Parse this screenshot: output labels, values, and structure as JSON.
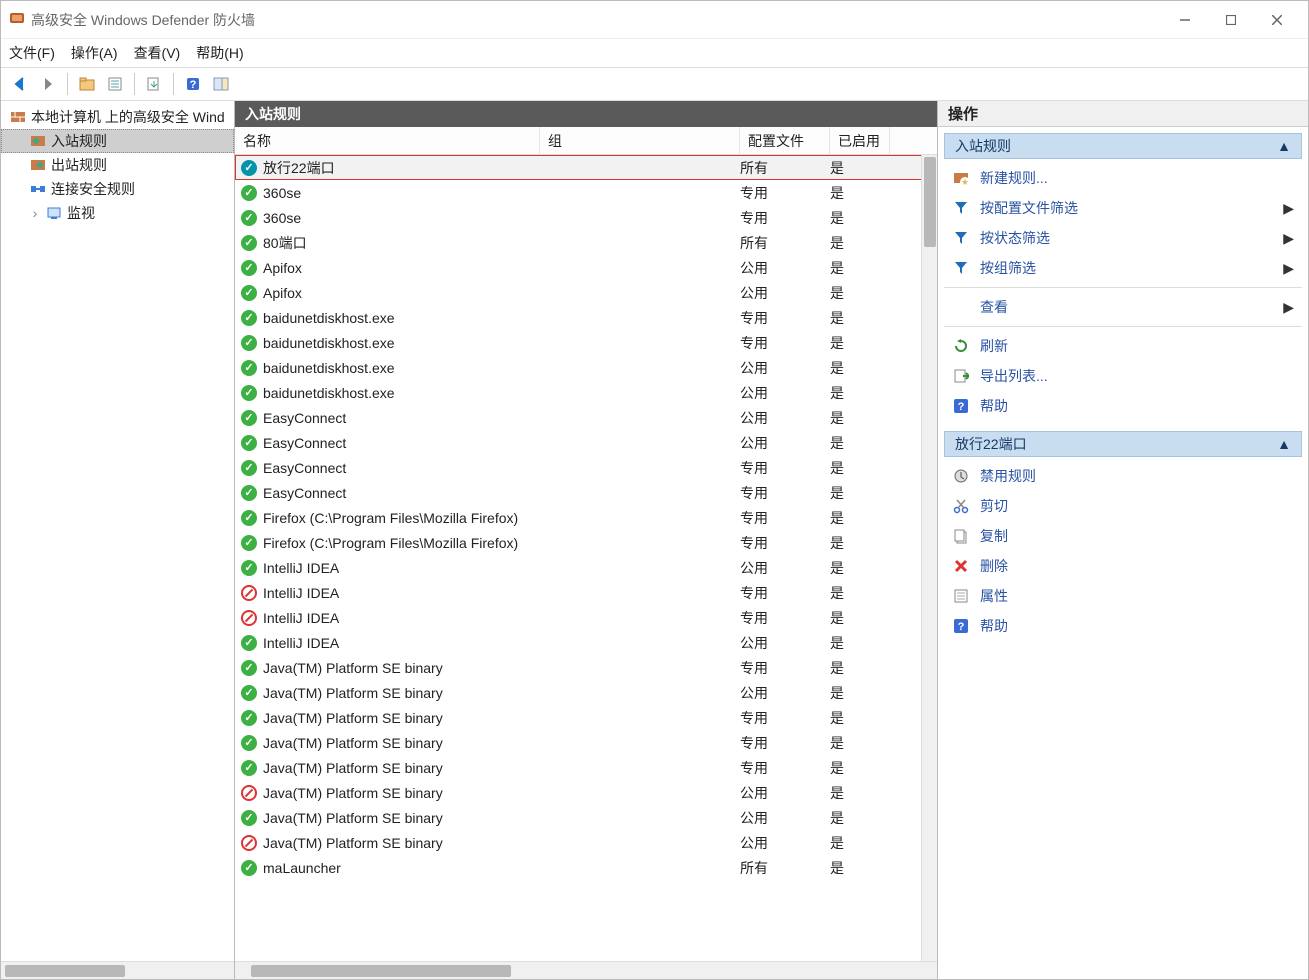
{
  "window": {
    "title": "高级安全 Windows Defender 防火墙"
  },
  "menu": {
    "file": "文件(F)",
    "action": "操作(A)",
    "view": "查看(V)",
    "help": "帮助(H)"
  },
  "tree": {
    "root": "本地计算机 上的高级安全 Wind",
    "inbound": "入站规则",
    "outbound": "出站规则",
    "connsec": "连接安全规则",
    "monitor": "监视"
  },
  "center": {
    "title": "入站规则",
    "columns": {
      "name": "名称",
      "group": "组",
      "profile": "配置文件",
      "enabled": "已启用"
    },
    "rules": [
      {
        "name": "放行22端口",
        "group": "",
        "profile": "所有",
        "enabled": "是",
        "icon": "custom",
        "selected": true,
        "highlighted": true
      },
      {
        "name": "360se",
        "group": "",
        "profile": "专用",
        "enabled": "是",
        "icon": "allow"
      },
      {
        "name": "360se",
        "group": "",
        "profile": "专用",
        "enabled": "是",
        "icon": "allow"
      },
      {
        "name": "80端口",
        "group": "",
        "profile": "所有",
        "enabled": "是",
        "icon": "allow"
      },
      {
        "name": "Apifox",
        "group": "",
        "profile": "公用",
        "enabled": "是",
        "icon": "allow"
      },
      {
        "name": "Apifox",
        "group": "",
        "profile": "公用",
        "enabled": "是",
        "icon": "allow"
      },
      {
        "name": "baidunetdiskhost.exe",
        "group": "",
        "profile": "专用",
        "enabled": "是",
        "icon": "allow"
      },
      {
        "name": "baidunetdiskhost.exe",
        "group": "",
        "profile": "专用",
        "enabled": "是",
        "icon": "allow"
      },
      {
        "name": "baidunetdiskhost.exe",
        "group": "",
        "profile": "公用",
        "enabled": "是",
        "icon": "allow"
      },
      {
        "name": "baidunetdiskhost.exe",
        "group": "",
        "profile": "公用",
        "enabled": "是",
        "icon": "allow"
      },
      {
        "name": "EasyConnect",
        "group": "",
        "profile": "公用",
        "enabled": "是",
        "icon": "allow"
      },
      {
        "name": "EasyConnect",
        "group": "",
        "profile": "公用",
        "enabled": "是",
        "icon": "allow"
      },
      {
        "name": "EasyConnect",
        "group": "",
        "profile": "专用",
        "enabled": "是",
        "icon": "allow"
      },
      {
        "name": "EasyConnect",
        "group": "",
        "profile": "专用",
        "enabled": "是",
        "icon": "allow"
      },
      {
        "name": "Firefox (C:\\Program Files\\Mozilla Firefox)",
        "group": "",
        "profile": "专用",
        "enabled": "是",
        "icon": "allow"
      },
      {
        "name": "Firefox (C:\\Program Files\\Mozilla Firefox)",
        "group": "",
        "profile": "专用",
        "enabled": "是",
        "icon": "allow"
      },
      {
        "name": "IntelliJ IDEA",
        "group": "",
        "profile": "公用",
        "enabled": "是",
        "icon": "allow"
      },
      {
        "name": "IntelliJ IDEA",
        "group": "",
        "profile": "专用",
        "enabled": "是",
        "icon": "block"
      },
      {
        "name": "IntelliJ IDEA",
        "group": "",
        "profile": "专用",
        "enabled": "是",
        "icon": "block"
      },
      {
        "name": "IntelliJ IDEA",
        "group": "",
        "profile": "公用",
        "enabled": "是",
        "icon": "allow"
      },
      {
        "name": "Java(TM) Platform SE binary",
        "group": "",
        "profile": "专用",
        "enabled": "是",
        "icon": "allow"
      },
      {
        "name": "Java(TM) Platform SE binary",
        "group": "",
        "profile": "公用",
        "enabled": "是",
        "icon": "allow"
      },
      {
        "name": "Java(TM) Platform SE binary",
        "group": "",
        "profile": "专用",
        "enabled": "是",
        "icon": "allow"
      },
      {
        "name": "Java(TM) Platform SE binary",
        "group": "",
        "profile": "专用",
        "enabled": "是",
        "icon": "allow"
      },
      {
        "name": "Java(TM) Platform SE binary",
        "group": "",
        "profile": "专用",
        "enabled": "是",
        "icon": "allow"
      },
      {
        "name": "Java(TM) Platform SE binary",
        "group": "",
        "profile": "公用",
        "enabled": "是",
        "icon": "block"
      },
      {
        "name": "Java(TM) Platform SE binary",
        "group": "",
        "profile": "公用",
        "enabled": "是",
        "icon": "allow"
      },
      {
        "name": "Java(TM) Platform SE binary",
        "group": "",
        "profile": "公用",
        "enabled": "是",
        "icon": "block"
      },
      {
        "name": "maLauncher",
        "group": "",
        "profile": "所有",
        "enabled": "是",
        "icon": "allow"
      }
    ]
  },
  "actions": {
    "title": "操作",
    "section1": "入站规则",
    "newRule": "新建规则...",
    "filterProfile": "按配置文件筛选",
    "filterState": "按状态筛选",
    "filterGroup": "按组筛选",
    "viewMenu": "查看",
    "refresh": "刷新",
    "exportList": "导出列表...",
    "help": "帮助",
    "section2": "放行22端口",
    "disableRule": "禁用规则",
    "cut": "剪切",
    "copy": "复制",
    "delete": "删除",
    "properties": "属性",
    "help2": "帮助"
  }
}
